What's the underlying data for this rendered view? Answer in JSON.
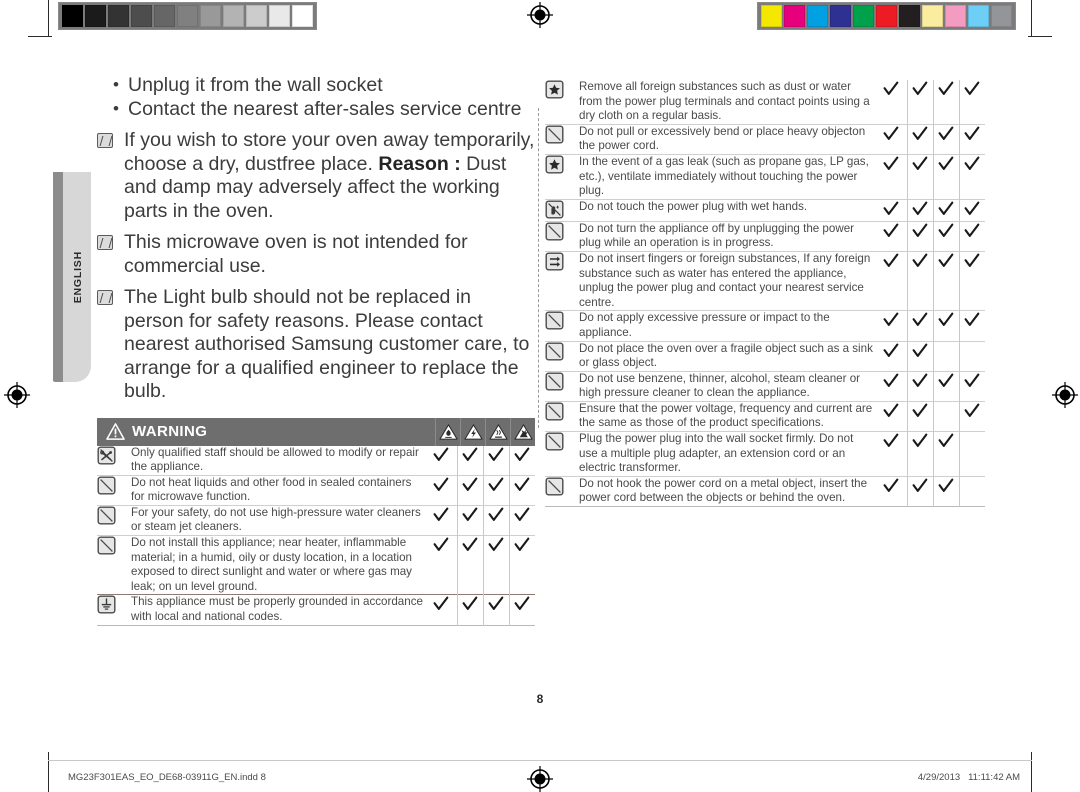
{
  "page": {
    "number": "8",
    "language_tab": "ENGLISH"
  },
  "footer": {
    "file": "MG23F301EAS_EO_DE68-03911G_EN.indd   8",
    "date": "4/29/2013",
    "time": "11:11:42 AM"
  },
  "calibration": {
    "gray_label": "grayscale-calibration-strip",
    "gray_patches": [
      "#000000",
      "#1b1b1b",
      "#333333",
      "#4d4d4d",
      "#666666",
      "#808080",
      "#999999",
      "#b3b3b3",
      "#cccccc",
      "#e9e9e9",
      "#ffffff"
    ],
    "color_label": "color-calibration-strip",
    "color_patches": [
      "#f5e800",
      "#e6007e",
      "#00a0e2",
      "#2e3192",
      "#00a14b",
      "#ed1c24",
      "#231f20",
      "#faeda0",
      "#f49bc1",
      "#6dcff6",
      "#939598"
    ]
  },
  "intro": {
    "bullets": [
      "Unplug it from the wall socket",
      "Contact the nearest after-sales service centre"
    ],
    "notes": [
      {
        "text": "If you wish to store your oven away temporarily, choose a dry, dustfree place.",
        "reason_label": "Reason : ",
        "reason_text": "Dust and damp may adversely affect the working parts in the oven."
      },
      {
        "text": "This microwave oven is not intended for commercial use."
      },
      {
        "text": "The Light bulb should not be replaced in person for safety reasons.",
        "extra": "Please contact nearest authorised Samsung customer care, to arrange for a qualified engineer to replace the bulb."
      }
    ]
  },
  "warning_header": {
    "title": "WARNING",
    "hazard_icons": [
      "flammable-hazard-icon",
      "electric-shock-hazard-icon",
      "hot-surface-hazard-icon",
      "explosion-hazard-icon"
    ]
  },
  "left_table": {
    "rows": [
      {
        "icon": "no-repair-icon",
        "text": "Only qualified staff should be allowed to modify or repair the appliance.",
        "checks": [
          true,
          true,
          true,
          true
        ]
      },
      {
        "icon": "prohibited-icon",
        "text": "Do not heat liquids and other food in sealed containers for microwave function.",
        "checks": [
          true,
          true,
          true,
          true
        ]
      },
      {
        "icon": "prohibited-icon",
        "text": "For your safety, do not use high-pressure water cleaners or steam jet cleaners.",
        "checks": [
          true,
          true,
          true,
          true
        ]
      },
      {
        "icon": "prohibited-icon",
        "text": "Do not install this appliance; near heater, inflammable material; in a humid, oily or dusty location, in a location exposed to direct sunlight and water or where gas may leak; on un level ground.",
        "checks": [
          true,
          true,
          true,
          true
        ]
      },
      {
        "icon": "ground-icon",
        "text": "This appliance must be properly grounded in accordance with local and national codes.",
        "checks": [
          true,
          true,
          true,
          true
        ]
      }
    ]
  },
  "right_table": {
    "rows": [
      {
        "icon": "mandatory-star-icon",
        "text": "Remove all foreign substances such as dust or water from the power plug terminals and contact points using a dry cloth on a regular basis.",
        "checks": [
          true,
          true,
          true,
          true
        ]
      },
      {
        "icon": "prohibited-icon",
        "text": "Do not pull or excessively bend or place heavy objecton the power cord.",
        "checks": [
          true,
          true,
          true,
          true
        ]
      },
      {
        "icon": "mandatory-star-icon",
        "text": "In the event of a gas leak (such as propane gas, LP gas, etc.), ventilate immediately without touching the power plug.",
        "checks": [
          true,
          true,
          true,
          true
        ]
      },
      {
        "icon": "no-wet-hands-icon",
        "text": "Do not touch the power plug with wet hands.",
        "checks": [
          true,
          true,
          true,
          true
        ]
      },
      {
        "icon": "prohibited-icon",
        "text": "Do not turn the appliance off by unplugging the power plug while an operation is in progress.",
        "checks": [
          true,
          true,
          true,
          true
        ]
      },
      {
        "icon": "no-insert-icon",
        "text": "Do not insert fingers or foreign substances, If any foreign substance such as water has entered the appliance, unplug the power plug and contact your nearest service centre.",
        "checks": [
          true,
          true,
          true,
          true
        ]
      },
      {
        "icon": "prohibited-icon",
        "text": "Do not apply excessive pressure or impact to the appliance.",
        "checks": [
          true,
          true,
          true,
          true
        ]
      },
      {
        "icon": "prohibited-icon",
        "text": "Do not place the oven over a fragile object such as a sink or glass object.",
        "checks": [
          true,
          true,
          false,
          false
        ]
      },
      {
        "icon": "prohibited-icon",
        "text": "Do not use benzene, thinner, alcohol, steam cleaner or high pressure cleaner to clean the appliance.",
        "checks": [
          true,
          true,
          true,
          true
        ]
      },
      {
        "icon": "prohibited-icon",
        "text": "Ensure that the power voltage, frequency and current are the same as those of the product specifications.",
        "checks": [
          true,
          true,
          false,
          true
        ]
      },
      {
        "icon": "prohibited-icon",
        "text": "Plug the power plug into the wall socket firmly. Do not use a multiple plug adapter, an extension cord or an electric transformer.",
        "checks": [
          true,
          true,
          true,
          false
        ]
      },
      {
        "icon": "prohibited-icon",
        "text": "Do not hook the power cord on a metal object, insert the power cord between the objects or behind the oven.",
        "checks": [
          true,
          true,
          true,
          false
        ]
      }
    ]
  }
}
